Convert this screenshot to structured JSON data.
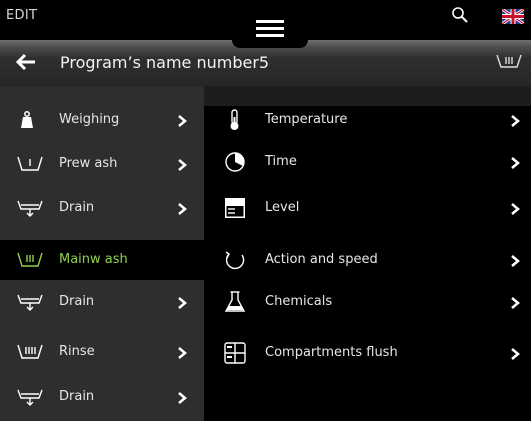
{
  "topbar": {
    "edit_label": "EDIT",
    "menu_icon": "hamburger-menu-icon",
    "search_icon": "search-icon",
    "language_icon": "uk-flag-icon"
  },
  "header": {
    "back_icon": "back-arrow-icon",
    "title": "Program’s name number5",
    "program_icon": "main-wash-icon"
  },
  "steps": [
    {
      "label": "Weighing",
      "icon": "weight-icon",
      "active": false
    },
    {
      "label": "Prew ash",
      "icon": "prewash-icon",
      "active": false
    },
    {
      "label": "Drain",
      "icon": "drain-icon",
      "active": false
    },
    {
      "label": "Mainw ash",
      "icon": "main-wash-icon",
      "active": true
    },
    {
      "label": "Drain",
      "icon": "drain-icon",
      "active": false
    },
    {
      "label": "Rinse",
      "icon": "rinse-icon",
      "active": false
    },
    {
      "label": "Drain",
      "icon": "drain-icon",
      "active": false
    }
  ],
  "settings": [
    {
      "label": "Temperature",
      "icon": "thermometer-icon"
    },
    {
      "label": "Time",
      "icon": "clock-icon"
    },
    {
      "label": "Level",
      "icon": "level-icon"
    },
    {
      "label": "Action and speed",
      "icon": "rotation-icon"
    },
    {
      "label": "Chemicals",
      "icon": "flask-icon"
    },
    {
      "label": "Compartments flush",
      "icon": "compartments-icon"
    }
  ],
  "colors": {
    "accent_green": "#8fd14a",
    "left_panel": "#2e2e2e",
    "right_panel": "#000000"
  }
}
